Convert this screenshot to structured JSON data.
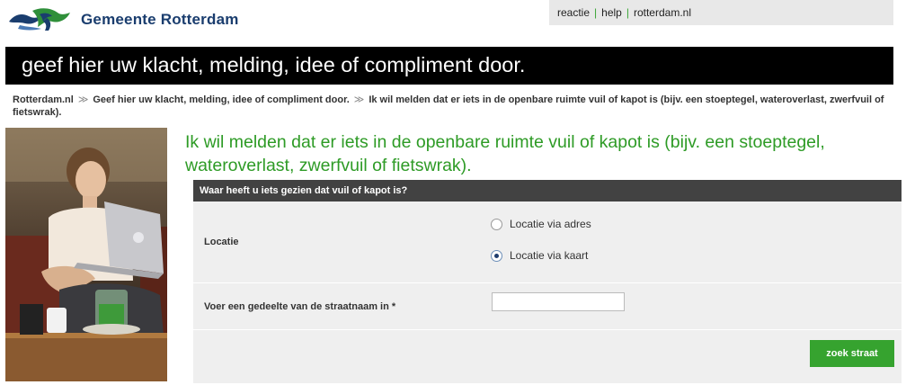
{
  "header": {
    "logo_text": "Gemeente Rotterdam",
    "links": [
      "reactie",
      "help",
      "rotterdam.nl"
    ]
  },
  "banner": {
    "title": "geef hier uw klacht, melding, idee of compliment door."
  },
  "breadcrumb": {
    "items": [
      "Rotterdam.nl",
      "Geef hier uw klacht, melding, idee of compliment door.",
      "Ik wil melden dat er iets in de openbare ruimte vuil of kapot is (bijv. een stoeptegel, wateroverlast, zwerfvuil of fietswrak)."
    ]
  },
  "page": {
    "heading": "Ik wil melden dat er iets in de openbare ruimte vuil of kapot is (bijv. een stoeptegel, wateroverlast, zwerfvuil of fietswrak)."
  },
  "form": {
    "section_title": "Waar heeft u iets gezien dat vuil of kapot is?",
    "location_label": "Locatie",
    "location_options": [
      {
        "label": "Locatie via adres",
        "selected": false
      },
      {
        "label": "Locatie via kaart",
        "selected": true
      }
    ],
    "street_label": "Voer een gedeelte van de straatnaam in *",
    "street_value": "",
    "search_button": "zoek straat"
  },
  "colors": {
    "accent_green": "#36a32f",
    "heading_green": "#2e9b26",
    "banner_black": "#000000",
    "form_header": "#424242",
    "form_bg": "#efefef",
    "logo_blue": "#1a3d6e"
  },
  "icons": [
    "rotterdam-lion-logo",
    "breadcrumb-arrow-icon",
    "radio-unselected",
    "radio-selected"
  ]
}
